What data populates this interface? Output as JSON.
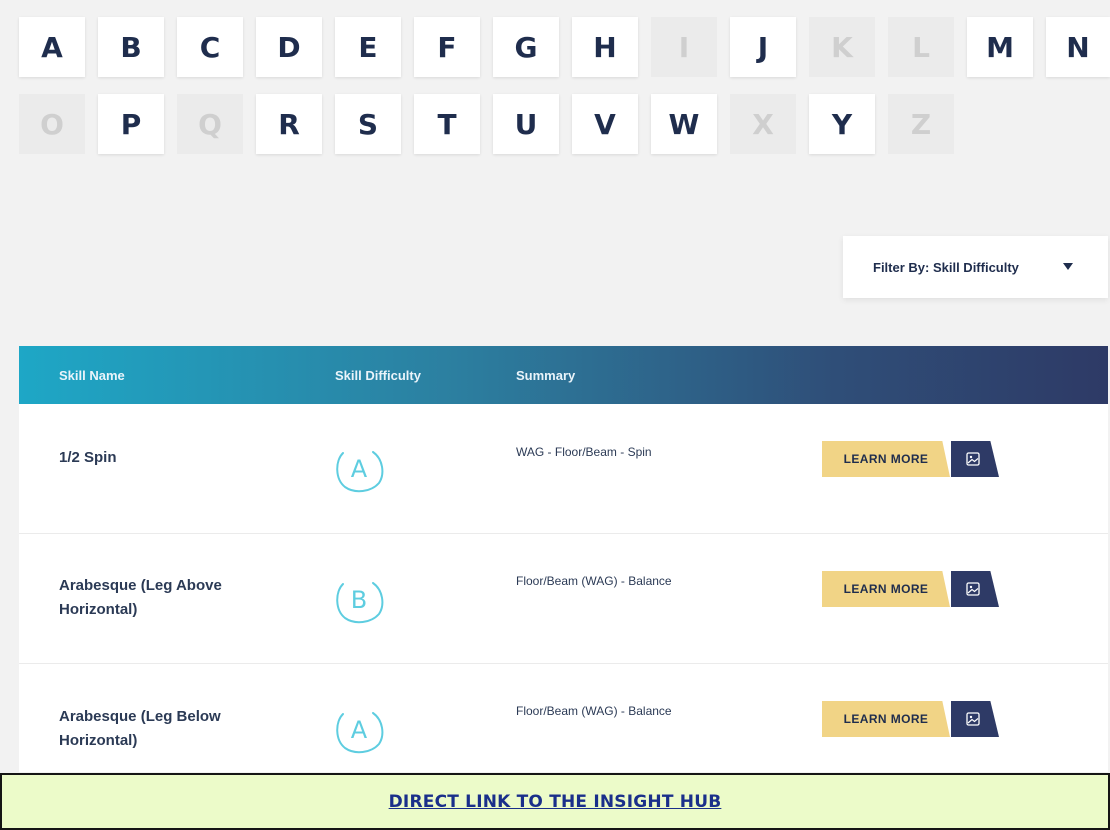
{
  "letters": [
    {
      "char": "A",
      "enabled": true
    },
    {
      "char": "B",
      "enabled": true
    },
    {
      "char": "C",
      "enabled": true
    },
    {
      "char": "D",
      "enabled": true
    },
    {
      "char": "E",
      "enabled": true
    },
    {
      "char": "F",
      "enabled": true
    },
    {
      "char": "G",
      "enabled": true
    },
    {
      "char": "H",
      "enabled": true
    },
    {
      "char": "I",
      "enabled": false
    },
    {
      "char": "J",
      "enabled": true
    },
    {
      "char": "K",
      "enabled": false
    },
    {
      "char": "L",
      "enabled": false
    },
    {
      "char": "M",
      "enabled": true
    },
    {
      "char": "N",
      "enabled": true
    },
    {
      "char": "O",
      "enabled": false
    },
    {
      "char": "P",
      "enabled": true
    },
    {
      "char": "Q",
      "enabled": false
    },
    {
      "char": "R",
      "enabled": true
    },
    {
      "char": "S",
      "enabled": true
    },
    {
      "char": "T",
      "enabled": true
    },
    {
      "char": "U",
      "enabled": true
    },
    {
      "char": "V",
      "enabled": true
    },
    {
      "char": "W",
      "enabled": true
    },
    {
      "char": "X",
      "enabled": false
    },
    {
      "char": "Y",
      "enabled": true
    },
    {
      "char": "Z",
      "enabled": false
    }
  ],
  "filter": {
    "label": "Filter By: Skill Difficulty",
    "caret_icon": "caret-down-icon"
  },
  "table": {
    "headers": {
      "skill_name": "Skill Name",
      "skill_difficulty": "Skill Difficulty",
      "summary": "Summary"
    },
    "rows": [
      {
        "name": "1/2 Spin",
        "grade": "A",
        "summary": "WAG - Floor/Beam - Spin",
        "learn_more": "LEARN MORE",
        "media_icon": "image-icon"
      },
      {
        "name": "Arabesque (Leg Above Horizontal)",
        "grade": "B",
        "summary": "Floor/Beam (WAG) - Balance",
        "learn_more": "LEARN MORE",
        "media_icon": "image-icon"
      },
      {
        "name": "Arabesque (Leg Below Horizontal)",
        "grade": "A",
        "summary": "Floor/Beam (WAG) - Balance",
        "learn_more": "LEARN MORE",
        "media_icon": "image-icon"
      }
    ]
  },
  "banner": {
    "link_text": "DIRECT LINK TO THE INSIGHT HUB"
  },
  "colors": {
    "page_bg": "#f2f2f2",
    "navy": "#1f2d4d",
    "header_gradient_start": "#1ea7c6",
    "header_gradient_end": "#2e3a66",
    "learn_more_bg": "#f1d486",
    "grade_circle": "#5ecde0",
    "banner_bg": "#ecfbc9",
    "banner_link": "#1a2f8a"
  }
}
